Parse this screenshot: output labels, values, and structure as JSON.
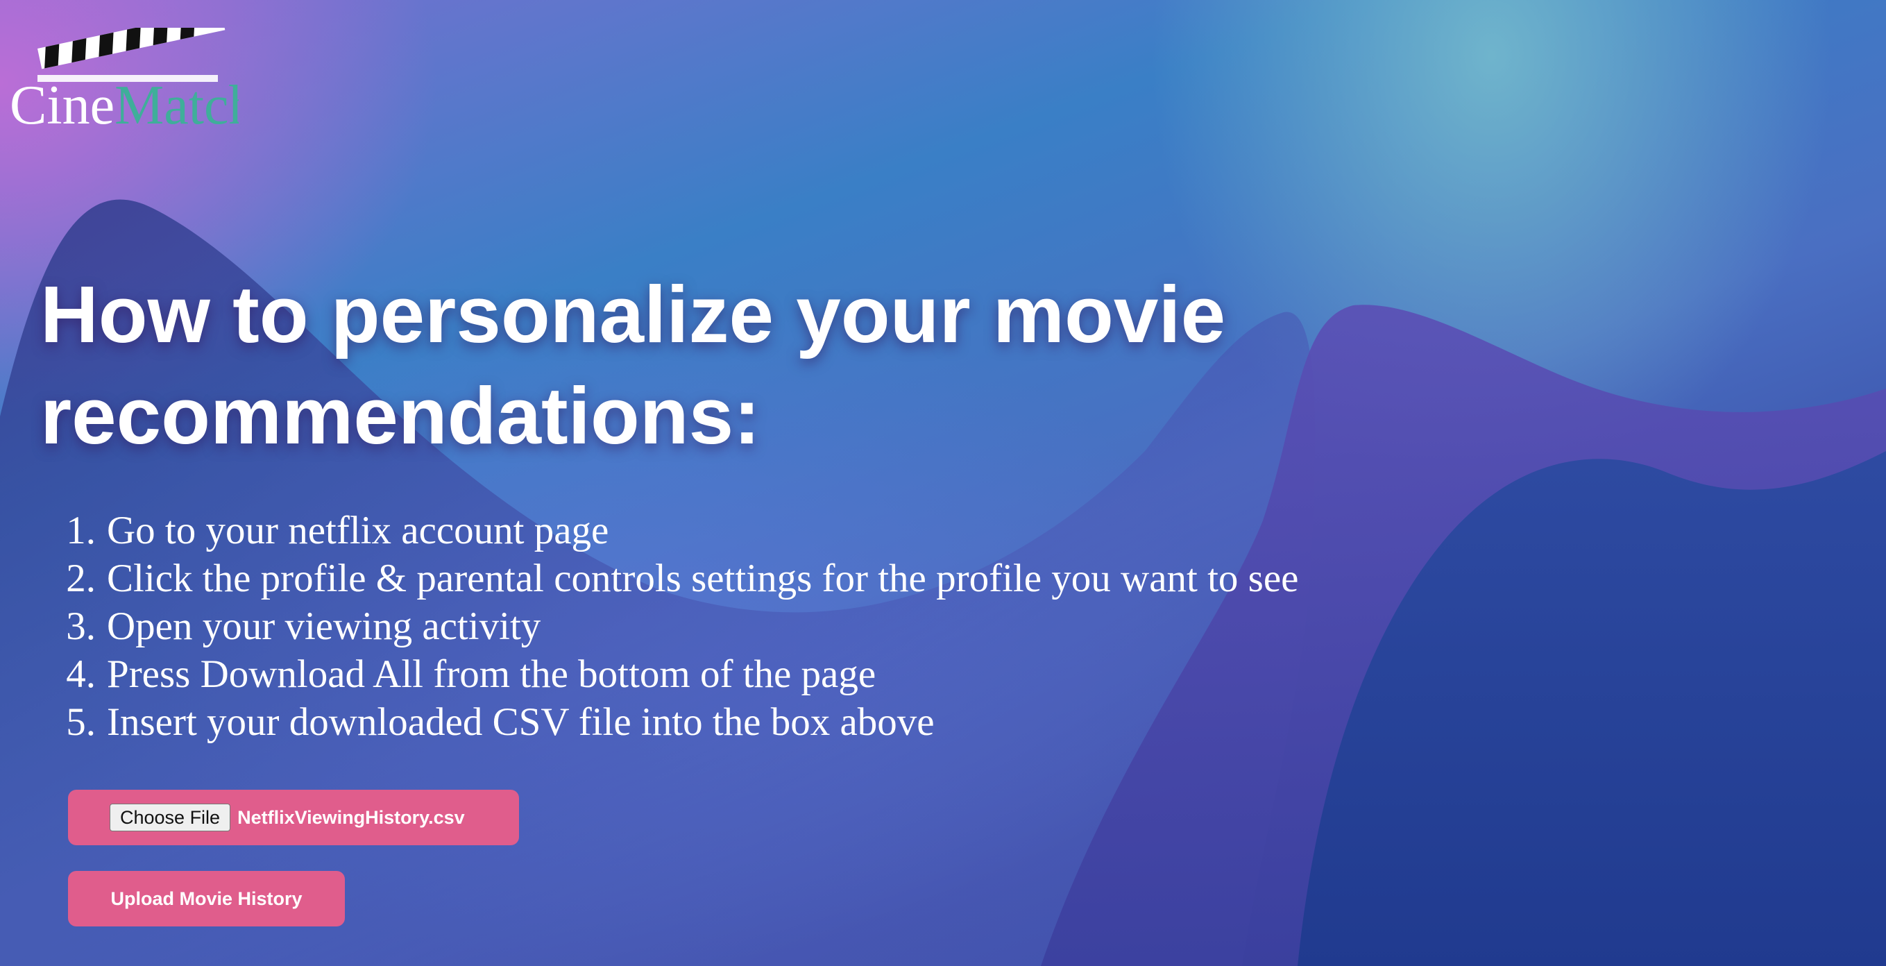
{
  "brand": {
    "logo_text_primary": "Cine",
    "logo_text_secondary": "Match",
    "primary_color": "#ffffff",
    "secondary_color": "#3fae9a",
    "logo_icon": "clapperboard-icon"
  },
  "main": {
    "title": "How to personalize your movie recommendations:",
    "steps": [
      {
        "number": "1.",
        "text": "Go to your netflix account page"
      },
      {
        "number": "2.",
        "text": "Click the profile & parental controls settings for the profile you want to see"
      },
      {
        "number": "3.",
        "text": "Open your viewing activity"
      },
      {
        "number": "4.",
        "text": "Press Download All from the bottom of the page"
      },
      {
        "number": "5.",
        "text": "Insert your downloaded CSV file into the box above"
      }
    ]
  },
  "upload": {
    "choose_file_label": "Choose File",
    "selected_file": "NetflixViewingHistory.csv",
    "upload_button_label": "Upload Movie History",
    "accent_color": "#e05d8c"
  }
}
